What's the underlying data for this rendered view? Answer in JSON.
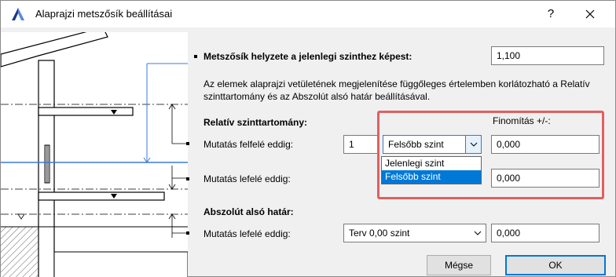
{
  "window": {
    "title": "Alaprajzi metszősík beállításai",
    "help_label": "?"
  },
  "section_top": {
    "label": "Metszősík helyzete a jelenlegi szinthez képest:",
    "value": "1,100"
  },
  "description": "Az elemek alaprajzi vetületének megjelenítése függőleges értelemben korlátozható a Relatív szinttartomány és az Abszolút alsó határ beállításával.",
  "relative": {
    "heading": "Relatív szinttartomány:",
    "refine_label": "Finomítás +/-:",
    "upward": {
      "label": "Mutatás felfelé eddig:",
      "count": "1",
      "combo_value": "Felsőbb szint",
      "refine_value": "0,000"
    },
    "downward": {
      "label": "Mutatás lefelé eddig:",
      "refine_value": "0,000"
    },
    "dropdown_options": [
      "Jelenlegi szint",
      "Felsőbb szint"
    ],
    "dropdown_selected_index": 1
  },
  "absolute": {
    "heading": "Abszolút alsó határ:",
    "label": "Mutatás lefelé eddig:",
    "combo_value": "Terv 0,00 szint",
    "refine_value": "0,000"
  },
  "buttons": {
    "cancel": "Mégse",
    "ok": "OK"
  },
  "colors": {
    "accent": "#0078d7",
    "highlight": "#e06060",
    "cut_plane": "#3c78dc"
  }
}
